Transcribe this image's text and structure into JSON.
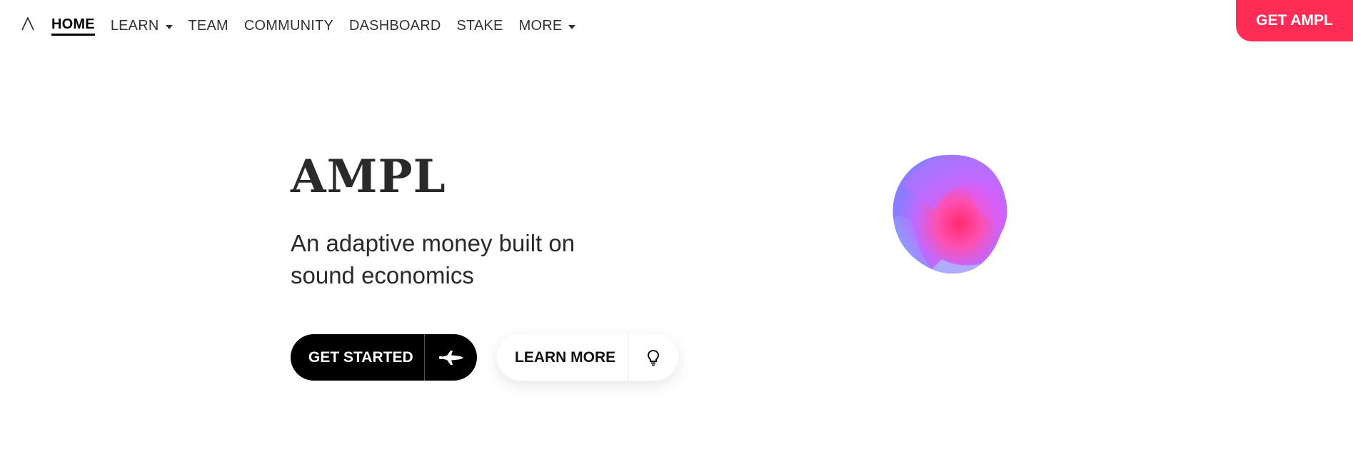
{
  "nav": {
    "logo_icon": "lambda-logo-icon",
    "items": [
      {
        "label": "HOME",
        "active": true,
        "dropdown": false
      },
      {
        "label": "LEARN",
        "active": false,
        "dropdown": true
      },
      {
        "label": "TEAM",
        "active": false,
        "dropdown": false
      },
      {
        "label": "COMMUNITY",
        "active": false,
        "dropdown": false
      },
      {
        "label": "DASHBOARD",
        "active": false,
        "dropdown": false
      },
      {
        "label": "STAKE",
        "active": false,
        "dropdown": false
      },
      {
        "label": "MORE",
        "active": false,
        "dropdown": true
      }
    ],
    "cta_label": "GET AMPL"
  },
  "hero": {
    "title": "AMPL",
    "subtitle": "An adaptive money built on sound economics",
    "primary_button": {
      "label": "GET STARTED",
      "icon": "space-shuttle-icon"
    },
    "secondary_button": {
      "label": "LEARN MORE",
      "icon": "lightbulb-icon"
    },
    "orb": "gradient-sphere-graphic"
  },
  "colors": {
    "accent": "#ff2d55",
    "text": "#2a2a2a",
    "primary_button_bg": "#000000"
  }
}
